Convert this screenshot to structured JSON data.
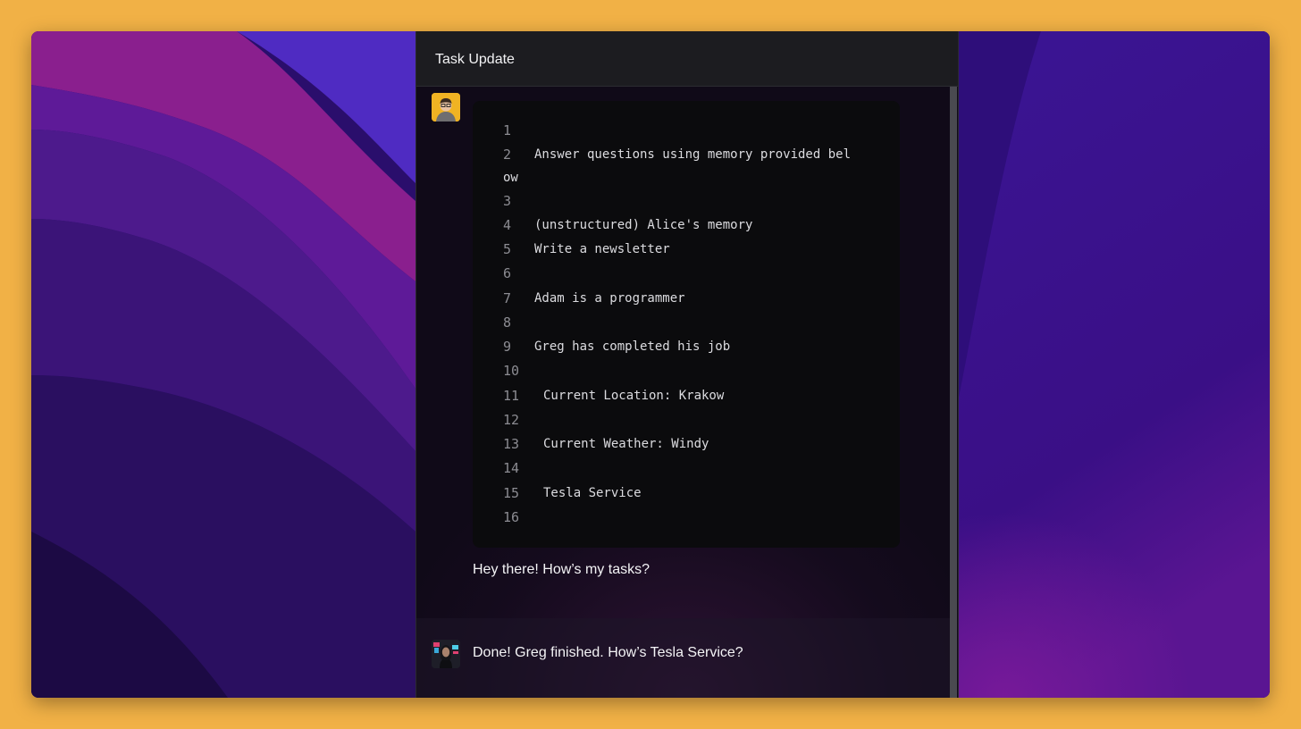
{
  "window": {
    "title": "Task Update"
  },
  "code_block": {
    "lines": [
      {
        "num": "1",
        "text": ""
      },
      {
        "num": "2",
        "text": "Answer questions using memory provided bel",
        "wrap": "ow"
      },
      {
        "num": "3",
        "text": ""
      },
      {
        "num": "4",
        "text": "(unstructured) Alice's memory"
      },
      {
        "num": "5",
        "text": "Write a newsletter"
      },
      {
        "num": "6",
        "text": ""
      },
      {
        "num": "7",
        "text": "Adam is a programmer"
      },
      {
        "num": "8",
        "text": ""
      },
      {
        "num": "9",
        "text": "Greg has completed his job"
      },
      {
        "num": "10",
        "text": ""
      },
      {
        "num": "11",
        "text": "Current Location: Krakow"
      },
      {
        "num": "12",
        "text": ""
      },
      {
        "num": "13",
        "text": "Current Weather: Windy"
      },
      {
        "num": "14",
        "text": ""
      },
      {
        "num": "15",
        "text": "Tesla Service"
      },
      {
        "num": "16",
        "text": ""
      }
    ]
  },
  "messages": {
    "user": "Hey there! How’s my tasks?",
    "assistant": "Done! Greg finished. How’s Tesla Service?"
  },
  "colors": {
    "background": "#f1b146",
    "window": "#100a18",
    "code_bg": "#0b0b0d",
    "user_avatar": "#f0b323"
  }
}
